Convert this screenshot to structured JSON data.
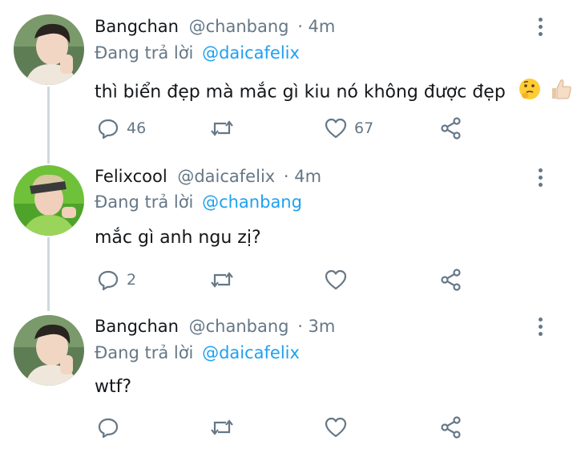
{
  "tweets": [
    {
      "name": "Bangchan",
      "handle": "@chanbang",
      "time": "· 4m",
      "reply_prefix": "Đang trả lời",
      "reply_to": "@daicafelix",
      "text": "thì biển đẹp mà mắc gì kiu nó không được đẹp",
      "emojis": [
        "thinking-face-icon",
        "thumbs-up-icon"
      ],
      "replies": "46",
      "likes": "67"
    },
    {
      "name": "Felixcool",
      "handle": "@daicafelix",
      "time": "· 4m",
      "reply_prefix": "Đang trả lời",
      "reply_to": "@chanbang",
      "text": "mắc gì anh ngu zị?",
      "replies": "2",
      "likes": ""
    },
    {
      "name": "Bangchan",
      "handle": "@chanbang",
      "time": "· 3m",
      "reply_prefix": "Đang trả lời",
      "reply_to": "@daicafelix",
      "text": "wtf?",
      "replies": "",
      "likes": ""
    }
  ],
  "colors": {
    "text_primary": "#14171a",
    "text_secondary": "#657786",
    "mention": "#1da1f2",
    "thread_line": "#cfd9de"
  }
}
